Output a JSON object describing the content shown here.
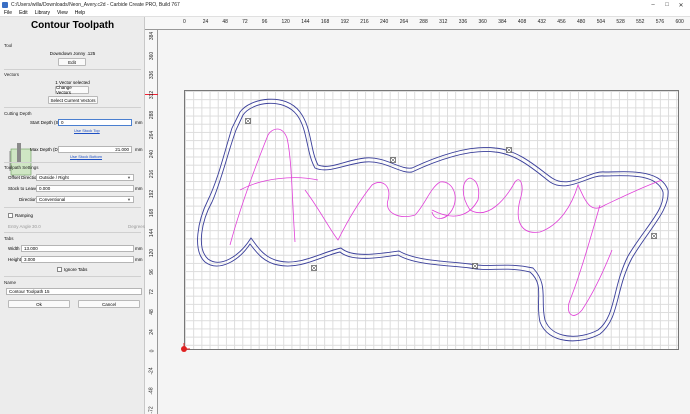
{
  "window": {
    "title": "C:/Users/willa/Downloads/Neon_Avery.c2d - Carbide Create PRO, Build 767"
  },
  "menu": {
    "items": [
      "File",
      "Edit",
      "Library",
      "View",
      "Help"
    ]
  },
  "panel": {
    "title": "Contour Toolpath",
    "tool": {
      "section": "Tool",
      "name": "Downdown Jonny .125",
      "edit_label": "Edit"
    },
    "vectors": {
      "section": "Vectors",
      "status": "1 Vector selected",
      "change_label": "Change Vectors",
      "select_current_label": "Select Current Vectors"
    },
    "cutting_depth": {
      "section": "Cutting Depth",
      "start_label": "Start Depth (S)",
      "start_value": "0",
      "start_unit": "mm",
      "use_stock_top": "Use Stock Top",
      "max_label": "Max Depth (D)",
      "max_value": "21.000",
      "max_unit": "mm",
      "use_stock_bottom": "Use Stock Bottom"
    },
    "toolpath_settings": {
      "section": "Toolpath Settings",
      "offset_label": "Offset Direction",
      "offset_value": "Outside / Right",
      "stock_label": "Stock to Leave",
      "stock_value": "0.000",
      "stock_unit": "mm",
      "direction_label": "Direction",
      "direction_value": "Conventional"
    },
    "ramping": {
      "label": "Ramping",
      "entry_label": "Entry Angle",
      "entry_value": "30.0",
      "entry_unit": "Degrees"
    },
    "tabs": {
      "section": "Tabs",
      "width_label": "Width",
      "width_value": "13.000",
      "width_unit": "mm",
      "height_label": "Height",
      "height_value": "3.000",
      "height_unit": "mm",
      "ignore_label": "Ignore Tabs"
    },
    "name": {
      "section": "Name",
      "value": "Contour Toolpath 15"
    },
    "ok_label": "Ok",
    "cancel_label": "Cancel"
  },
  "ruler": {
    "x_ticks": [
      "0",
      "24",
      "48",
      "72",
      "96",
      "120",
      "144",
      "168",
      "192",
      "216",
      "240",
      "264",
      "288",
      "312",
      "336",
      "360",
      "384",
      "408",
      "432",
      "456",
      "480",
      "504",
      "528",
      "552",
      "576",
      "600"
    ],
    "y_ticks": [
      "384",
      "360",
      "336",
      "312",
      "288",
      "264",
      "240",
      "216",
      "192",
      "168",
      "144",
      "120",
      "96",
      "72",
      "48",
      "24",
      "0",
      "-24",
      "-48",
      "-72"
    ]
  },
  "colors": {
    "vector": "#3a3f9a",
    "toolpath": "#e040d8",
    "origin": "#e02020"
  }
}
